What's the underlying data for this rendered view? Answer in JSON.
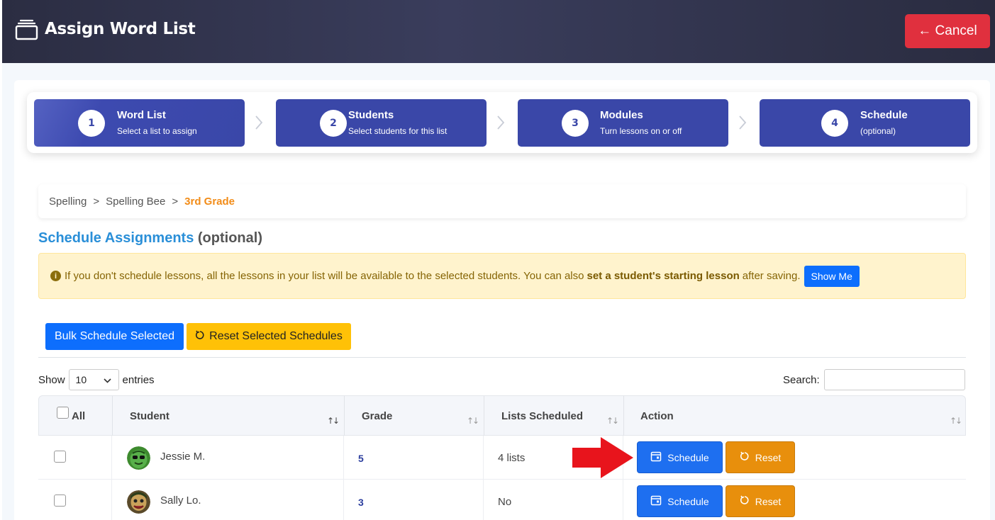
{
  "header": {
    "title": "Assign Word List",
    "cancel_label": "← Cancel"
  },
  "steps": [
    {
      "num": "1",
      "label": "Word List",
      "sub": "Select a list to assign"
    },
    {
      "num": "2",
      "label": "Students",
      "sub": "Select students for this list"
    },
    {
      "num": "3",
      "label": "Modules",
      "sub": "Turn lessons on or off"
    },
    {
      "num": "4",
      "label": "Schedule",
      "sub": "(optional)"
    }
  ],
  "breadcrumb": {
    "items": [
      "Spelling",
      "Spelling Bee"
    ],
    "separator": ">",
    "current": "3rd Grade"
  },
  "section": {
    "title_main": "Schedule Assignments",
    "title_suffix": "(optional)"
  },
  "alert": {
    "text_before": "If you don't schedule lessons, all the lessons in your list will be available to the selected students. You can also",
    "bold_text": "set a student's starting lesson",
    "text_after": "after saving.",
    "show_me_label": "Show Me"
  },
  "actions": {
    "bulk_label": "Bulk Schedule Selected",
    "reset_selected_label": "Reset Selected Schedules"
  },
  "table_controls": {
    "show_label": "Show",
    "entries_value": "10",
    "entries_label": "entries",
    "search_label": "Search:",
    "search_value": ""
  },
  "table": {
    "headers": {
      "all": "All",
      "student": "Student",
      "grade": "Grade",
      "lists": "Lists Scheduled",
      "action": "Action"
    },
    "schedule_label": "Schedule",
    "reset_label": "Reset",
    "rows": [
      {
        "student": "Jessie M.",
        "grade": "5",
        "lists": "4 lists"
      },
      {
        "student": "Sally Lo.",
        "grade": "3",
        "lists": "No"
      }
    ]
  },
  "colors": {
    "step_bg": "#3a47a8",
    "cancel_bg": "#e0303e",
    "primary": "#0d6efd",
    "warning": "#ffc107",
    "reset_orange": "#e88f0c",
    "breadcrumb_current": "#f28c18",
    "arrow_red": "#e8141c"
  }
}
